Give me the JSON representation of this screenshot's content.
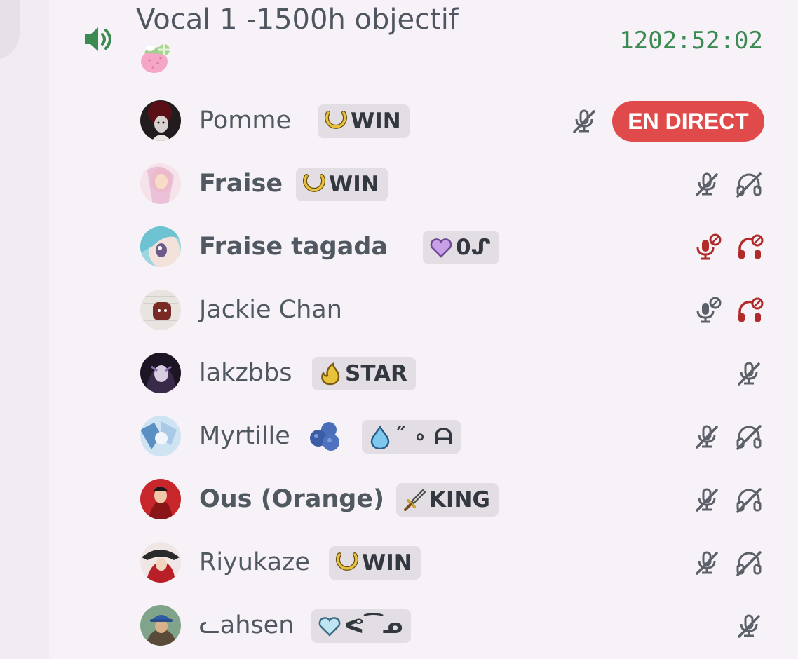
{
  "channel": {
    "title": "Vocal 1 -1500h objectif",
    "timer": "1202:52:02",
    "emoji": "strawberry-emoji"
  },
  "colors": {
    "background": "#f7f2f7",
    "timer": "#3a8a52",
    "live": "#e04a4a",
    "icon_muted": "#5c6169",
    "icon_server_muted": "#b12b2b",
    "tag_bg": "#e2dee3"
  },
  "members": [
    {
      "name": "Pomme",
      "tag": "WIN",
      "tag_icon": "crescent-moon-icon",
      "live_label": "EN DIRECT",
      "mic": "muted"
    },
    {
      "name": "Fraise",
      "tag": "WIN",
      "tag_icon": "crescent-moon-icon",
      "mic": "muted",
      "headset": "deafened"
    },
    {
      "name": "Fraise tagada",
      "tag": "0ᔑ",
      "tag_icon": "purple-heart-icon",
      "mic": "server-muted",
      "headset": "server-deafened"
    },
    {
      "name": "Jackie Chan",
      "mic": "server-muted-gray",
      "headset": "server-deafened"
    },
    {
      "name": "lakzbbs",
      "tag": "STAR",
      "tag_icon": "flame-icon",
      "mic": "muted"
    },
    {
      "name": "Myrtille",
      "name_emoji": "blueberry-emoji",
      "tag": "˝ ∘ ᗩ",
      "tag_icon": "water-drop-icon",
      "mic": "muted",
      "headset": "deafened"
    },
    {
      "name": "Ous (Orange)",
      "tag": "KING",
      "tag_icon": "sword-icon",
      "mic": "muted",
      "headset": "deafened"
    },
    {
      "name": "Riyukaze",
      "tag": "WIN",
      "tag_icon": "crescent-moon-icon",
      "mic": "muted",
      "headset": "deafened"
    },
    {
      "name": "ᓚahsen",
      "tag": "ᕙ⁀ᓄ",
      "tag_icon": "light-blue-heart-icon",
      "mic": "muted"
    }
  ]
}
